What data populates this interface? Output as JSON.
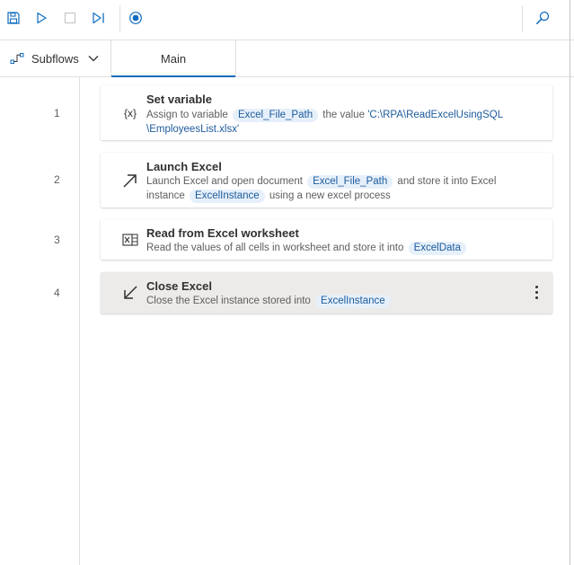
{
  "toolbar": {
    "save_icon": "save-icon",
    "run_icon": "play-icon",
    "stop_icon": "stop-icon",
    "next_icon": "run-next-icon",
    "record_icon": "record-icon",
    "search_icon": "search-icon"
  },
  "tabs": {
    "subflows_label": "Subflows",
    "main_label": "Main"
  },
  "colors": {
    "accent": "#0f6cbd",
    "token_bg": "#e6f0fa",
    "token_text": "#1c5a9c",
    "selected_bg": "#edebe9"
  },
  "actions": [
    {
      "line": "1",
      "icon": "{x}",
      "title": "Set variable",
      "d1": "Assign to variable",
      "var1": "Excel_File_Path",
      "d2": "the value",
      "literal1": "'C:\\RPA\\ReadExcelUsingSQL",
      "literal2": "\\EmployeesList.xlsx'"
    },
    {
      "line": "2",
      "title": "Launch Excel",
      "d1": "Launch Excel and open document",
      "var1": "Excel_File_Path",
      "d2": "and store it into Excel",
      "d3": "instance",
      "var2": "ExcelInstance",
      "d4": "using a new excel process"
    },
    {
      "line": "3",
      "title": "Read from Excel worksheet",
      "d1": "Read the values of all cells in worksheet and store it into",
      "var1": "ExcelData"
    },
    {
      "line": "4",
      "title": "Close Excel",
      "d1": "Close the Excel instance stored into",
      "var1": "ExcelInstance"
    }
  ]
}
